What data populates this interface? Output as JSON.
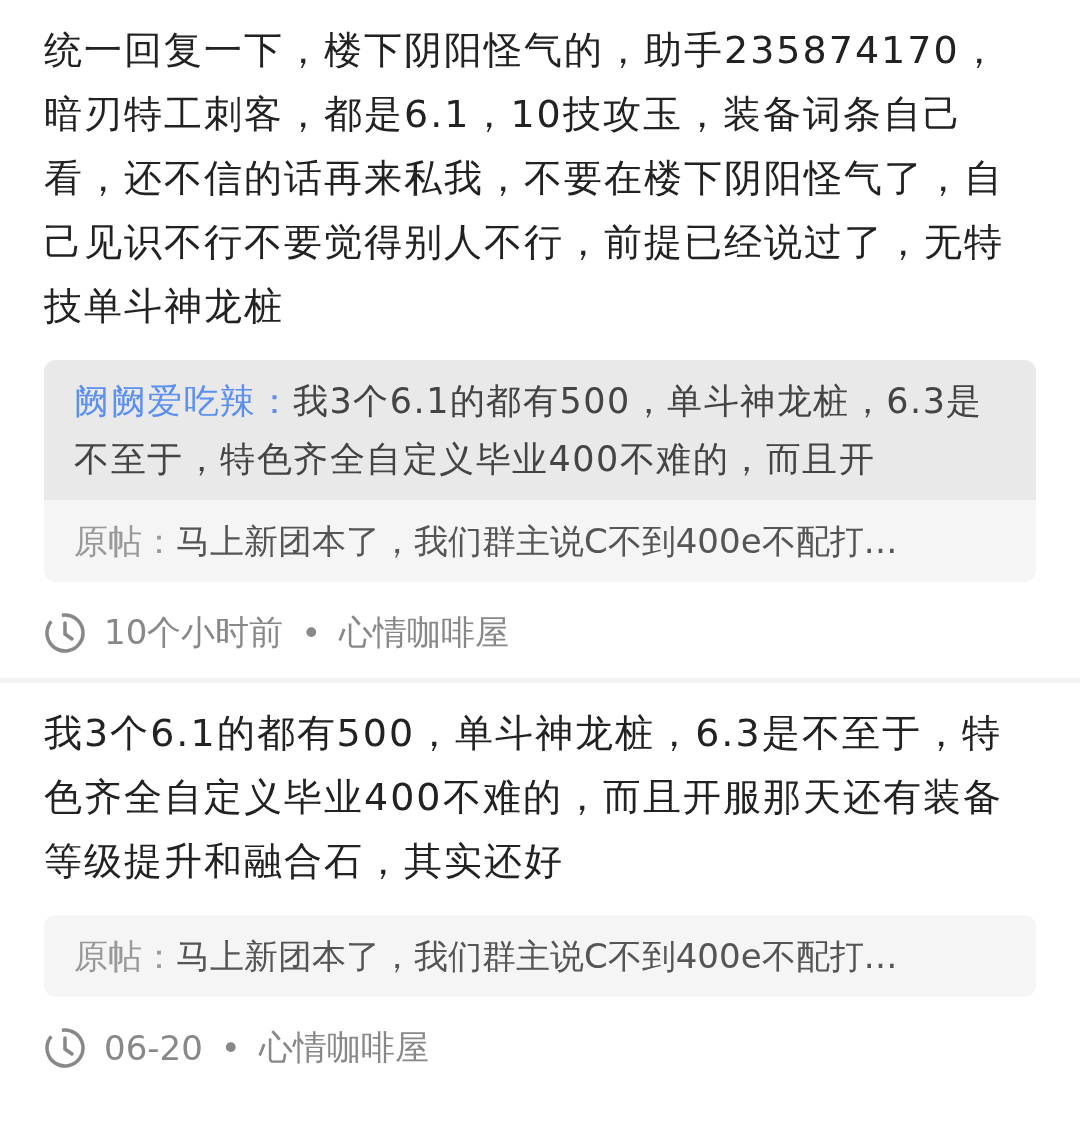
{
  "posts": [
    {
      "text": "统一回复一下，楼下阴阳怪气的，助手235874170，暗刃特工刺客，都是6.1，10技攻玉，装备词条自己看，还不信的话再来私我，不要在楼下阴阳怪气了，自己见识不行不要觉得别人不行，前提已经说过了，无特技单斗神龙桩",
      "reply": {
        "user": "阙阙爱吃辣：",
        "text": "我3个6.1的都有500，单斗神龙桩，6.3是不至于，特色齐全自定义毕业400不难的，而且开"
      },
      "original": {
        "label": "原帖：",
        "text": "马上新团本了，我们群主说C不到400e不配打…"
      },
      "time": "10个小时前",
      "separator": "•",
      "forum": "心情咖啡屋"
    },
    {
      "text": "我3个6.1的都有500，单斗神龙桩，6.3是不至于，特色齐全自定义毕业400不难的，而且开服那天还有装备等级提升和融合石，其实还好",
      "original": {
        "label": "原帖：",
        "text": "马上新团本了，我们群主说C不到400e不配打…"
      },
      "time": "06-20",
      "separator": "•",
      "forum": "心情咖啡屋"
    }
  ]
}
